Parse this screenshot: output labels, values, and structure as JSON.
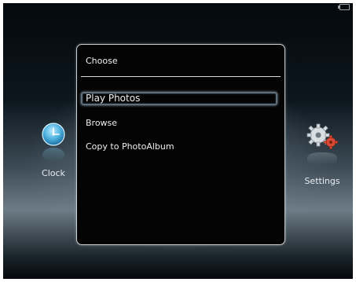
{
  "menu": {
    "title": "Choose",
    "items": [
      {
        "label": "Play Photos",
        "selected": true
      },
      {
        "label": "Browse",
        "selected": false
      },
      {
        "label": "Copy to PhotoAlbum",
        "selected": false
      }
    ]
  },
  "side_items": {
    "left": {
      "label": "Clock",
      "icon": "clock-icon"
    },
    "right": {
      "label": "Settings",
      "icon": "gear-icon"
    }
  },
  "status": {
    "icon": "battery-icon"
  },
  "colors": {
    "highlight_border": "#5d6f7c",
    "panel_background": "#040404",
    "text": "#eeeeee"
  }
}
